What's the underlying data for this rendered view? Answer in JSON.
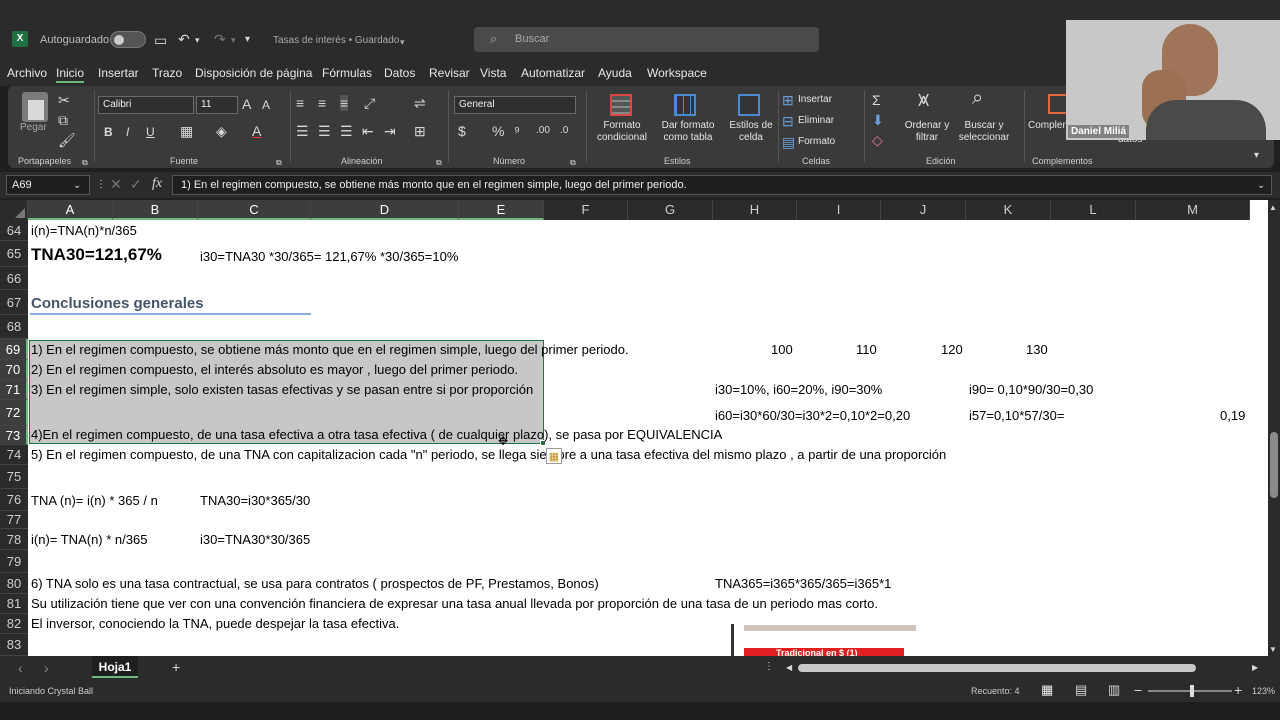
{
  "titlebar": {
    "app_icon": "excel-icon",
    "autosave_label": "Autoguardado",
    "doc_title": "Tasas de interés • Guardado",
    "search_placeholder": "Buscar"
  },
  "webcam": {
    "name": "Daniel Miliá"
  },
  "menu": [
    "Archivo",
    "Inicio",
    "Insertar",
    "Trazo",
    "Disposición de página",
    "Fórmulas",
    "Datos",
    "Revisar",
    "Vista",
    "Automatizar",
    "Ayuda",
    "Workspace"
  ],
  "ribbon": {
    "paste_label": "Pegar",
    "clipboard_group": "Portapapeles",
    "font_name": "Calibri",
    "font_size": "11",
    "font_group": "Fuente",
    "alignment_group": "Alineación",
    "number_format": "General",
    "number_group": "Número",
    "cond_format_label": "Formato condicional",
    "table_format_label": "Dar formato como tabla",
    "cell_styles_label": "Estilos de celda",
    "styles_group": "Estilos",
    "insert_label": "Insertar",
    "delete_label": "Eliminar",
    "format_label": "Formato",
    "cells_group": "Celdas",
    "sort_filter_label": "Ordenar y filtrar",
    "find_select_label": "Buscar y seleccionar",
    "editing_group": "Edición",
    "complements_label": "Complem",
    "complements_group": "Complementos",
    "data_label": "datos"
  },
  "formula_bar": {
    "name_box": "A69",
    "formula": "1) En el regimen compuesto, se obtiene más monto que en el regimen simple, luego del primer periodo."
  },
  "columns": [
    "A",
    "B",
    "C",
    "D",
    "E",
    "F",
    "G",
    "H",
    "I",
    "J",
    "K",
    "L",
    "M"
  ],
  "rows": [
    {
      "n": "64",
      "cells": [
        {
          "text": "i(n)=TNA(n)*n/365",
          "col": "a"
        }
      ]
    },
    {
      "n": "65",
      "cells": [
        {
          "text": "TNA30=121,67%",
          "col": "a",
          "bold": true
        },
        {
          "text": "i30=TNA30  *30/365= 121,67% *30/365=10%",
          "col": "c"
        }
      ]
    },
    {
      "n": "66",
      "cells": []
    },
    {
      "n": "67",
      "cells": [
        {
          "text": "Conclusiones generales",
          "col": "a",
          "heading": true
        }
      ]
    },
    {
      "n": "68",
      "cells": []
    },
    {
      "n": "69",
      "cells": [
        {
          "text": "1) En el regimen compuesto, se obtiene más monto que en el regimen simple, luego del primer periodo.",
          "col": "a"
        },
        {
          "text": "100",
          "col": "h"
        },
        {
          "text": "110",
          "col": "i"
        },
        {
          "text": "120",
          "col": "j"
        },
        {
          "text": "130",
          "col": "k"
        }
      ]
    },
    {
      "n": "70",
      "cells": [
        {
          "text": "2) En el regimen compuesto, el interés absoluto es mayor , luego del  primer periodo.",
          "col": "a"
        }
      ]
    },
    {
      "n": "71",
      "cells": [
        {
          "text": "3) En el regimen simple, solo existen tasas efectivas y se pasan entre si por proporción",
          "col": "a"
        },
        {
          "text": "i30=10%, i60=20%, i90=30%",
          "col": "h2"
        },
        {
          "text": "i90= 0,10*90/30=0,30",
          "col": "k2"
        }
      ]
    },
    {
      "n": "72",
      "cells": [
        {
          "text": "i60=i30*60/30=i30*2=0,10*2=0,20",
          "col": "h2"
        },
        {
          "text": "i57=0,10*57/30=",
          "col": "k2"
        },
        {
          "text": "0,19",
          "col": "m"
        }
      ]
    },
    {
      "n": "73",
      "cells": [
        {
          "text": "4)En el regimen compuesto, de una tasa efectiva a otra tasa efectiva ( de cualquier plazo), se pasa por EQUIVALENCIA",
          "col": "a"
        }
      ]
    },
    {
      "n": "74",
      "cells": [
        {
          "text": "5) En el regimen compuesto, de una TNA con capitalizacion cada \"n\" periodo, se llega siempre  a una tasa efectiva del mismo plazo , a partir de una proporción",
          "col": "a"
        }
      ]
    },
    {
      "n": "75",
      "cells": []
    },
    {
      "n": "76",
      "cells": [
        {
          "text": "TNA (n)=   i(n)  * 365 / n",
          "col": "a"
        },
        {
          "text": "TNA30=i30*365/30",
          "col": "c"
        }
      ]
    },
    {
      "n": "77",
      "cells": []
    },
    {
      "n": "78",
      "cells": [
        {
          "text": "i(n)= TNA(n) * n/365",
          "col": "a"
        },
        {
          "text": "i30=TNA30*30/365",
          "col": "c"
        }
      ]
    },
    {
      "n": "79",
      "cells": []
    },
    {
      "n": "80",
      "cells": [
        {
          "text": "6) TNA solo es una tasa contractual, se usa para contratos ( prospectos de PF, Prestamos, Bonos)",
          "col": "a"
        },
        {
          "text": "TNA365=i365*365/365=i365*1",
          "col": "h2"
        }
      ]
    },
    {
      "n": "81",
      "cells": [
        {
          "text": "Su utilización tiene que ver con una convención financiera de expresar una tasa anual llevada por proporción de una tasa de un periodo mas corto.",
          "col": "a"
        }
      ]
    },
    {
      "n": "82",
      "cells": [
        {
          "text": "El inversor, conociendo la TNA, puede despejar la tasa efectiva.",
          "col": "a"
        }
      ]
    },
    {
      "n": "83",
      "cells": []
    }
  ],
  "embedded_image_caption": "Tradicional en $ (1)",
  "sheet_tab": "Hoja1",
  "status": {
    "left": "Iniciando Crystal Ball",
    "count": "Recuento: 4",
    "zoom": "123%"
  }
}
